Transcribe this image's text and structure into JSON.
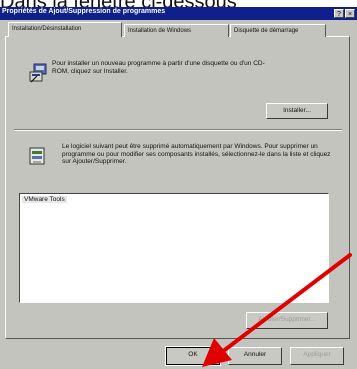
{
  "caption": {
    "text": "Dans la fenêtre ci-dessous"
  },
  "dialog": {
    "title": "Propriétés de Ajout/Suppression de programmes",
    "help_label": "?",
    "close_label": "×"
  },
  "tabs": [
    {
      "label": "Installation/Désinstallation"
    },
    {
      "label": "Installation de Windows"
    },
    {
      "label": "Disquette de démarrage"
    }
  ],
  "install_section": {
    "description": "Pour installer un nouveau programme à partir d'une disquette ou d'un CD-ROM, cliquez sur Installer.",
    "button_label": "Installer..."
  },
  "remove_section": {
    "description": "Le logiciel suivant peut être supprimé automatiquement par Windows. Pour supprimer un programme ou pour modifier ses composants installés, sélectionnez-le dans la liste et cliquez sur Ajouter/Supprimer.",
    "list": [
      "VMware Tools"
    ],
    "button_label": "Ajouter/Supprimer..."
  },
  "footer": {
    "ok_label": "OK",
    "cancel_label": "Annuler",
    "apply_label": "Appliquer"
  },
  "colors": {
    "titlebar": "#0f1f8c",
    "dialog_bg": "#c4c4bf",
    "arrow": "#e00000"
  },
  "icons": [
    "install-icon",
    "remove-icon"
  ]
}
